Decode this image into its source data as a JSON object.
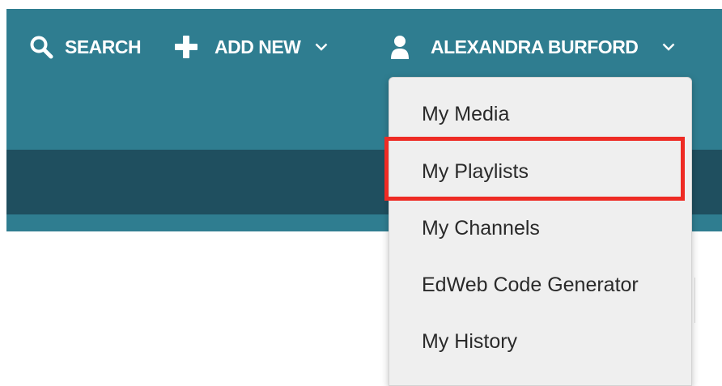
{
  "header": {
    "search_label": "SEARCH",
    "add_new_label": "ADD NEW",
    "user_name": "ALEXANDRA BURFORD"
  },
  "user_menu": {
    "items": [
      {
        "label": "My Media"
      },
      {
        "label": "My Playlists",
        "highlighted": true
      },
      {
        "label": "My Channels"
      },
      {
        "label": "EdWeb Code Generator"
      },
      {
        "label": "My History"
      }
    ]
  },
  "icons": [
    "search-icon",
    "plus-icon",
    "chevron-down-icon",
    "user-icon"
  ],
  "colors": {
    "header_bg": "#2f7d90",
    "subheader_bg": "#1f4f5f",
    "menu_bg": "#efefef",
    "highlight_border": "#ee2b24"
  }
}
